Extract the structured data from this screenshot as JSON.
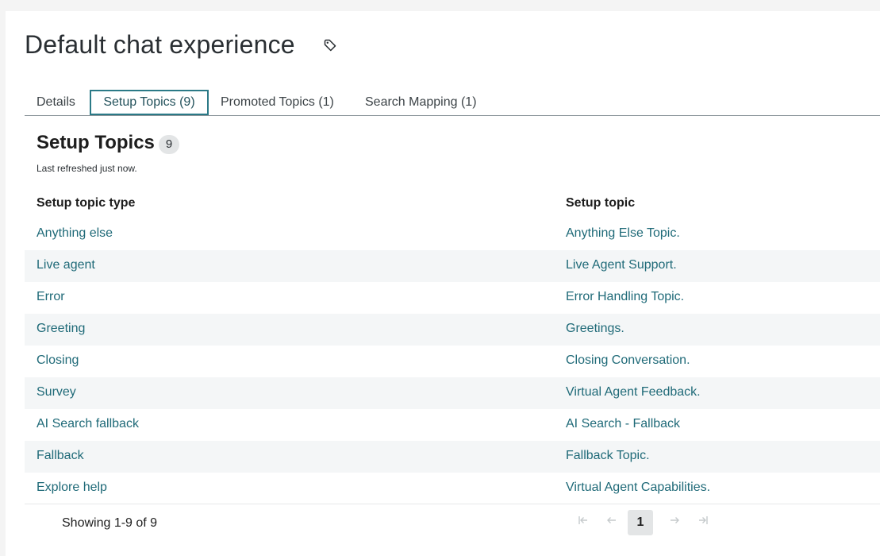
{
  "page": {
    "title": "Default chat experience",
    "tag_icon": "tag-icon"
  },
  "tabs": [
    {
      "label": "Details",
      "active": false
    },
    {
      "label": "Setup Topics (9)",
      "active": true
    },
    {
      "label": "Promoted Topics (1)",
      "active": false
    },
    {
      "label": "Search Mapping (1)",
      "active": false
    }
  ],
  "section": {
    "title": "Setup Topics",
    "count": "9",
    "refresh_text": "Last refreshed just now."
  },
  "table": {
    "columns": [
      "Setup topic type",
      "Setup topic"
    ],
    "rows": [
      [
        "Anything else",
        "Anything Else Topic."
      ],
      [
        "Live agent",
        "Live Agent Support."
      ],
      [
        "Error",
        "Error Handling Topic."
      ],
      [
        "Greeting",
        "Greetings."
      ],
      [
        "Closing",
        "Closing Conversation."
      ],
      [
        "Survey",
        "Virtual Agent Feedback."
      ],
      [
        "AI Search fallback",
        "AI Search - Fallback"
      ],
      [
        "Fallback",
        "Fallback Topic."
      ],
      [
        "Explore help",
        "Virtual Agent Capabilities."
      ]
    ]
  },
  "pagination": {
    "showing": "Showing 1-9 of 9",
    "current_page": "1",
    "buttons": [
      "first-page-icon",
      "prev-page-icon",
      "next-page-icon",
      "last-page-icon"
    ]
  },
  "colors": {
    "link": "#1f6a78",
    "active_tab_border": "#2b7a87",
    "row_alt": "#f4f6f7",
    "background": "#f4f4f4"
  }
}
